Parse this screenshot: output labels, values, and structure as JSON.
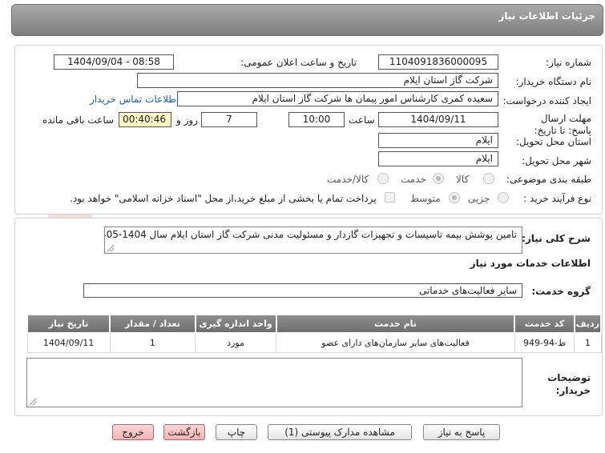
{
  "header": {
    "title": "جزئیات اطلاعات نیاز"
  },
  "watermark": {
    "text": "AriaTender.net"
  },
  "form": {
    "need_number_label": "شماره نیاز:",
    "need_number_value": "1104091836000095",
    "announce_datetime_label": "تاریخ و ساعت اعلان عمومی:",
    "announce_datetime_value": "1404/09/04 - 08:58",
    "buyer_org_label": "نام دستگاه خریدار:",
    "buyer_org_value": "شرکت گاز استان ایلام",
    "requester_label": "ایجاد کننده درخواست:",
    "requester_value": "سعیده کمری کارشناس امور پیمان ها شرکت گاز استان ایلام",
    "buyer_contact_link": "اطلاعات تماس خریدار",
    "deadline_label": "مهلت ارسال پاسخ: تا تاریخ:",
    "deadline_date": "1404/09/11",
    "time_label": "ساعت",
    "deadline_time": "10:00",
    "days_value": "7",
    "days_label": "روز و",
    "remaining_value": "00:40:46",
    "remaining_label": "ساعت باقی مانده",
    "province_label": "استان محل تحویل:",
    "province_value": "ایلام",
    "city_label": "شهر محل تحویل:",
    "city_value": "ایلام",
    "category_label": "طبقه بندی موضوعی:",
    "category_options": [
      "کالا",
      "خدمت",
      "کالا/خدمت"
    ],
    "category_selected": "خدمت",
    "process_label": "نوع فرآیند خرید :",
    "process_options": [
      "جزیی",
      "متوسط"
    ],
    "process_selected": "متوسط",
    "payment_note": "پرداخت تمام یا بخشی از مبلغ خرید،از محل \"اسناد خزانه اسلامی\" خواهد بود."
  },
  "details": {
    "description_label": "شرح کلی نیاز:",
    "description_value": "تامین پوشش بیمه تاسیسات و تجهیزات گازدار و مسئولیت مدنی شرکت گاز استان ایلام سال 1404-1405",
    "services_section_title": "اطلاعات خدمات مورد نیاز",
    "service_group_label": "گروه خدمت:",
    "service_group_value": "سایر فعالیت‌های خدماتی",
    "table": {
      "headers": [
        "ردیف",
        "کد خدمت",
        "نام خدمت",
        "واحد اندازه گیری",
        "تعداد / مقدار",
        "تاریخ نیاز"
      ],
      "rows": [
        [
          "1",
          "ط-94-949",
          "فعالیت‌های سایر سازمان‌های دارای عضو",
          "مورد",
          "1",
          "1404/09/11"
        ]
      ]
    },
    "buyer_notes_label": "توضیحات خریدار:",
    "buyer_notes_value": ""
  },
  "buttons": {
    "reply": "پاسخ به نیاز",
    "view_docs": "مشاهده مدارک پیوستی (1)",
    "print": "چاپ",
    "back": "بازگشت",
    "exit": "خروج"
  }
}
